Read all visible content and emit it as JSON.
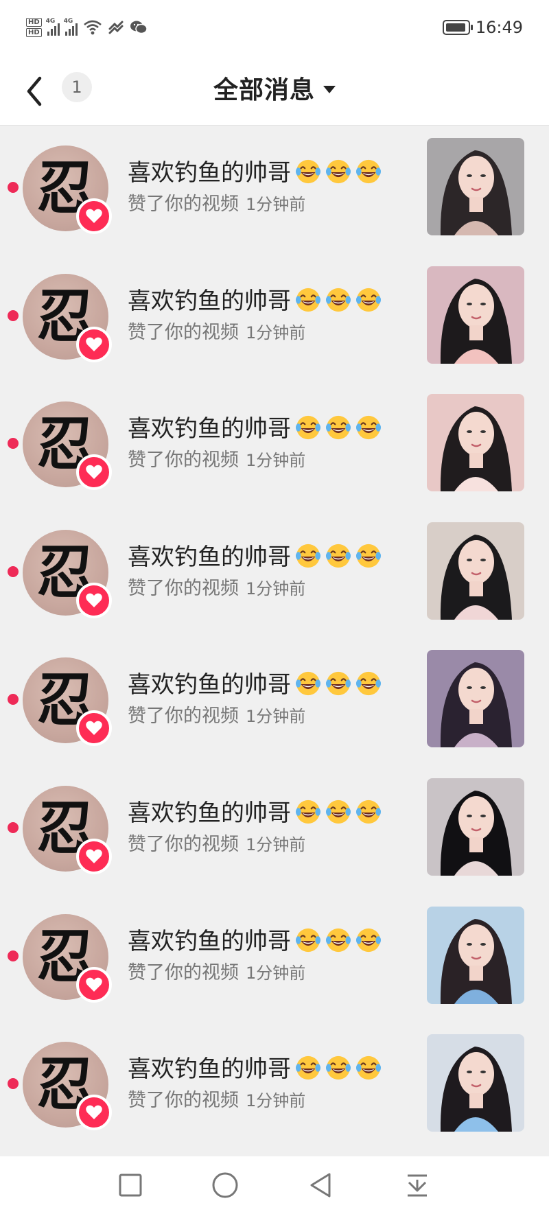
{
  "status_bar": {
    "hd_labels": [
      "HD",
      "HD"
    ],
    "network_labels": [
      "4G",
      "4G"
    ],
    "time": "16:49",
    "icons": [
      "wifi-icon",
      "nfc-icon",
      "wechat-icon",
      "battery-icon"
    ]
  },
  "header": {
    "back_icon": "chevron-left-icon",
    "unread_count": "1",
    "title": "全部消息",
    "dropdown_icon": "caret-down-icon"
  },
  "notifications": [
    {
      "avatar_char": "忍",
      "nickname": "喜欢钓鱼的帅哥",
      "action": "赞了你的视频",
      "time": "1分钟前",
      "thumb_colors": [
        "#a8a6a8",
        "#2c2628",
        "#d5b8b0"
      ]
    },
    {
      "avatar_char": "忍",
      "nickname": "喜欢钓鱼的帅哥",
      "action": "赞了你的视频",
      "time": "1分钟前",
      "thumb_colors": [
        "#d9b8c0",
        "#1d1a1c",
        "#f2c2bf"
      ]
    },
    {
      "avatar_char": "忍",
      "nickname": "喜欢钓鱼的帅哥",
      "action": "赞了你的视频",
      "time": "1分钟前",
      "thumb_colors": [
        "#e8c8c6",
        "#201c1e",
        "#f7e1de"
      ]
    },
    {
      "avatar_char": "忍",
      "nickname": "喜欢钓鱼的帅哥",
      "action": "赞了你的视频",
      "time": "1分钟前",
      "thumb_colors": [
        "#d8cec8",
        "#1b1a1c",
        "#f0d6d6"
      ]
    },
    {
      "avatar_char": "忍",
      "nickname": "喜欢钓鱼的帅哥",
      "action": "赞了你的视频",
      "time": "1分钟前",
      "thumb_colors": [
        "#9a8aa8",
        "#2a2230",
        "#c8b0c8"
      ]
    },
    {
      "avatar_char": "忍",
      "nickname": "喜欢钓鱼的帅哥",
      "action": "赞了你的视频",
      "time": "1分钟前",
      "thumb_colors": [
        "#c9c3c6",
        "#111013",
        "#e8d8d8"
      ]
    },
    {
      "avatar_char": "忍",
      "nickname": "喜欢钓鱼的帅哥",
      "action": "赞了你的视频",
      "time": "1分钟前",
      "thumb_colors": [
        "#b8d2e6",
        "#2a2226",
        "#7fb0de"
      ]
    },
    {
      "avatar_char": "忍",
      "nickname": "喜欢钓鱼的帅哥",
      "action": "赞了你的视频",
      "time": "1分钟前",
      "thumb_colors": [
        "#d6dde6",
        "#1e1a1e",
        "#8ec0ea"
      ]
    }
  ],
  "row_icons": {
    "unread": "unread-dot",
    "badge": "heart-icon",
    "emoji": "laughing-emoji-icon"
  },
  "system_nav": {
    "buttons": [
      "recent-apps-square-icon",
      "home-circle-icon",
      "back-triangle-icon",
      "notification-pulldown-icon"
    ]
  },
  "colors": {
    "accent": "#fe2c55",
    "unread_dot": "#ee2a57",
    "background": "#f0f0f0",
    "header_bg": "#ffffff"
  }
}
